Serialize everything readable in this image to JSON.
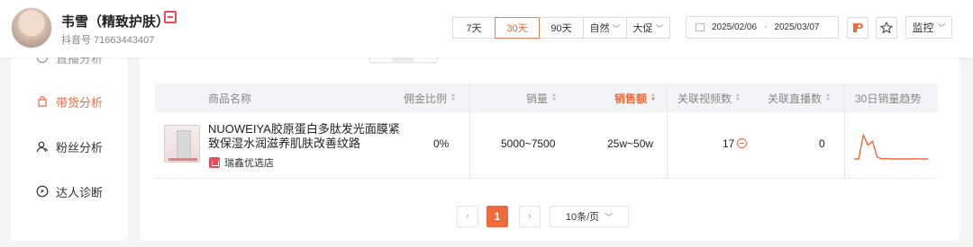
{
  "profile": {
    "name": "韦雪（精致护肤）",
    "shop_badge": "",
    "douyin_id": "抖音号 71663443407"
  },
  "filters": {
    "periods": [
      "7天",
      "30天",
      "90天"
    ],
    "active_period": "30天",
    "traffic": "自然",
    "promo": "大促",
    "date_start": "2025/02/06",
    "date_sep": "-",
    "date_end": "2025/03/07",
    "monitor_label": "监控"
  },
  "sidebar": {
    "items": [
      {
        "label": "直播分析",
        "icon": "live-icon"
      },
      {
        "label": "带货分析",
        "icon": "bag-icon"
      },
      {
        "label": "粉丝分析",
        "icon": "fans-icon"
      },
      {
        "label": "达人诊断",
        "icon": "diagnose-icon"
      }
    ],
    "active": "带货分析"
  },
  "table": {
    "columns": [
      "商品名称",
      "佣金比例",
      "销量",
      "销售额",
      "关联视频数",
      "关联直播数",
      "30日销量趋势"
    ],
    "rows": [
      {
        "product_name": "NUOWEIYA胶原蛋白多肽发光面膜紧致保湿水润滋养肌肤改善纹路",
        "shop": "瑞鑫优选店",
        "commission": "0%",
        "sales_volume": "5000~7500",
        "sales_amount": "25w~50w",
        "video_count": "17",
        "live_count": "0",
        "trend": [
          0,
          0,
          0.95,
          0.55,
          0.7,
          0.08,
          0,
          0.02,
          0,
          0,
          0,
          0,
          0,
          0.01,
          0,
          0,
          0
        ]
      }
    ]
  },
  "pagination": {
    "prev": "‹",
    "current": "1",
    "next": "›",
    "page_size": "10条/页"
  },
  "colors": {
    "accent": "#f06a3c",
    "brand_red": "#f04a57"
  }
}
